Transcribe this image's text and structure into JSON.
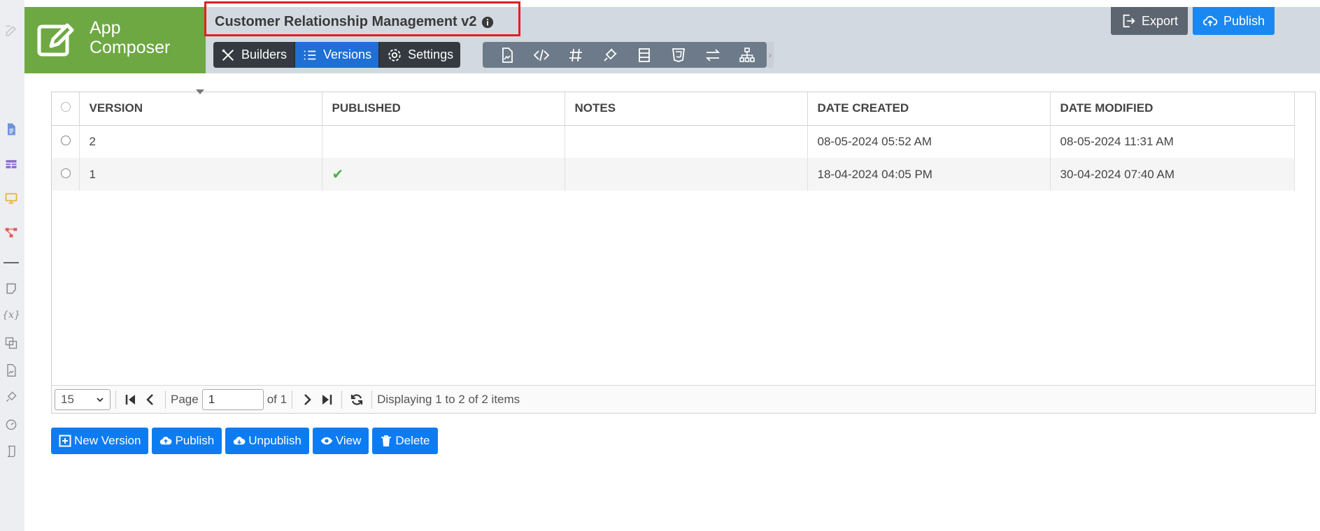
{
  "app": {
    "name_line1": "App",
    "name_line2": "Composer",
    "accent": "#6ea843"
  },
  "header": {
    "title": "Customer Relationship Management v2",
    "export_label": "Export",
    "publish_label": "Publish"
  },
  "nav": {
    "builders_label": "Builders",
    "versions_label": "Versions",
    "settings_label": "Settings"
  },
  "toolbar_icons": [
    "image-file-icon",
    "code-icon",
    "hash-icon",
    "plugin-icon",
    "layout-rows-icon",
    "html5-icon",
    "transfer-icon",
    "sitemap-icon"
  ],
  "rail": {
    "variable_glyph": "{x}"
  },
  "grid": {
    "columns": [
      "VERSION",
      "PUBLISHED",
      "NOTES",
      "DATE CREATED",
      "DATE MODIFIED"
    ],
    "rows": [
      {
        "version": "2",
        "published": "",
        "notes": "",
        "created": "08-05-2024 05:52 AM",
        "modified": "08-05-2024 11:31 AM"
      },
      {
        "version": "1",
        "published": "✔",
        "notes": "",
        "created": "18-04-2024 04:05 PM",
        "modified": "30-04-2024 07:40 AM"
      }
    ]
  },
  "pager": {
    "page_size": "15",
    "page_label": "Page",
    "page_value": "1",
    "of_label": "of 1",
    "summary": "Displaying 1 to 2 of 2 items"
  },
  "actions": {
    "new_version": "New Version",
    "publish": "Publish",
    "unpublish": "Unpublish",
    "view": "View",
    "delete": "Delete"
  }
}
